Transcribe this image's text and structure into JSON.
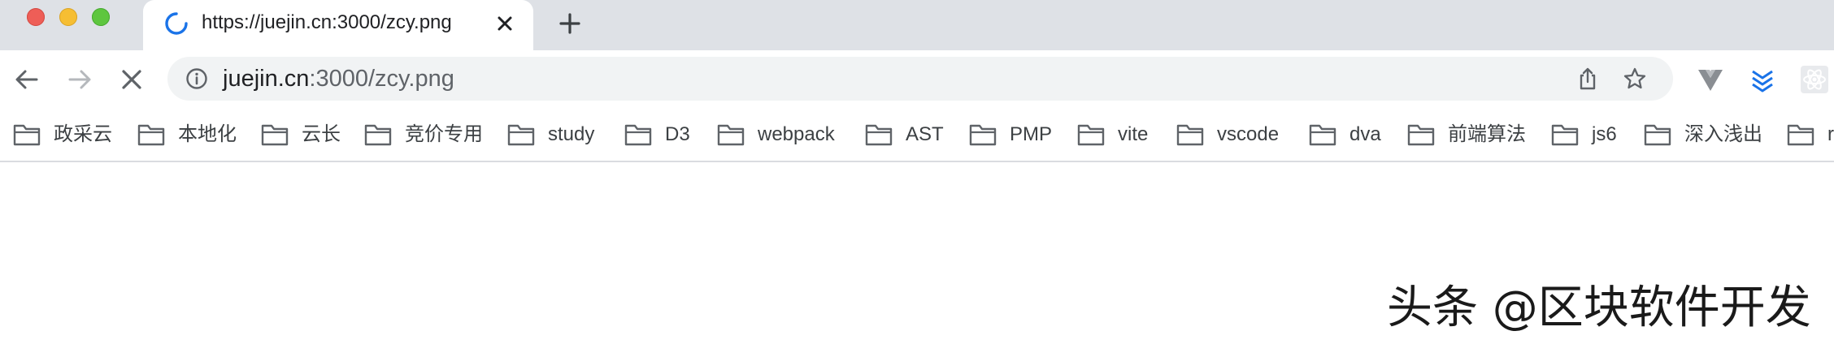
{
  "window": {
    "controls": [
      "close",
      "minimize",
      "maximize"
    ]
  },
  "tab": {
    "title": "https://juejin.cn:3000/zcy.png",
    "state": "loading"
  },
  "toolbar": {
    "url_host": "juejin.cn",
    "url_rest": ":3000/zcy.png",
    "icons": [
      "back-icon",
      "forward-icon",
      "stop-icon",
      "info-icon",
      "share-icon",
      "star-icon",
      "vue-devtools-icon",
      "chevron-stack-icon",
      "react-devtools-icon"
    ]
  },
  "bookmarks": [
    "政采云",
    "本地化",
    "云长",
    "竞价专用",
    "study",
    "D3",
    "webpack",
    "AST",
    "PMP",
    "vite",
    "vscode",
    "dva",
    "前端算法",
    "js6",
    "深入浅出",
    "r"
  ],
  "watermark": "头条 @区块软件开发",
  "colors": {
    "tabstrip": "#dee1e6",
    "omnibox": "#f1f3f4",
    "spinner": "#1a73e8"
  }
}
